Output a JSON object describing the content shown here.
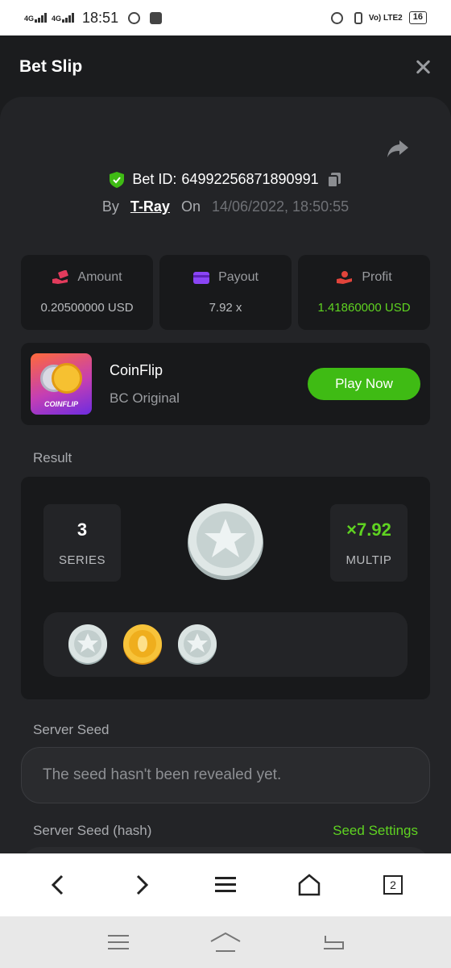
{
  "status_bar": {
    "net1": "4G",
    "net2": "4G",
    "time": "18:51",
    "volte": "Vo) LTE2",
    "battery": "16"
  },
  "header": {
    "title": "Bet Slip"
  },
  "bet": {
    "id_label": "Bet ID:",
    "id_value": "64992256871890991",
    "by_label": "By",
    "user": "T-Ray",
    "on_label": "On",
    "datetime": "14/06/2022, 18:50:55"
  },
  "stats": [
    {
      "label": "Amount",
      "value": "0.20500000 USD",
      "icon": "money-hand-icon",
      "color": "#e23b5c"
    },
    {
      "label": "Payout",
      "value": "7.92 x",
      "icon": "wallet-icon",
      "color": "#8a45f5"
    },
    {
      "label": "Profit",
      "value": "1.41860000 USD",
      "icon": "profit-hand-icon",
      "color": "#e2443b"
    }
  ],
  "game": {
    "name": "CoinFlip",
    "subtitle": "BC Original",
    "thumb_label": "COINFLIP",
    "play_label": "Play Now"
  },
  "result": {
    "label": "Result",
    "series_value": "3",
    "series_label": "SERIES",
    "multiplier_value": "×7.92",
    "multiplier_label": "MULTIP",
    "history": [
      "silver",
      "gold",
      "silver"
    ]
  },
  "seed": {
    "server_seed_label": "Server Seed",
    "server_seed_value": "The seed hasn't been revealed yet.",
    "hash_label": "Server Seed (hash)",
    "settings_link": "Seed Settings"
  },
  "browser_bar": {
    "tab_count": "2"
  },
  "colors": {
    "accent_green": "#5fd321",
    "button_green": "#3fbb14",
    "panel": "#232427",
    "card": "#18191b"
  }
}
